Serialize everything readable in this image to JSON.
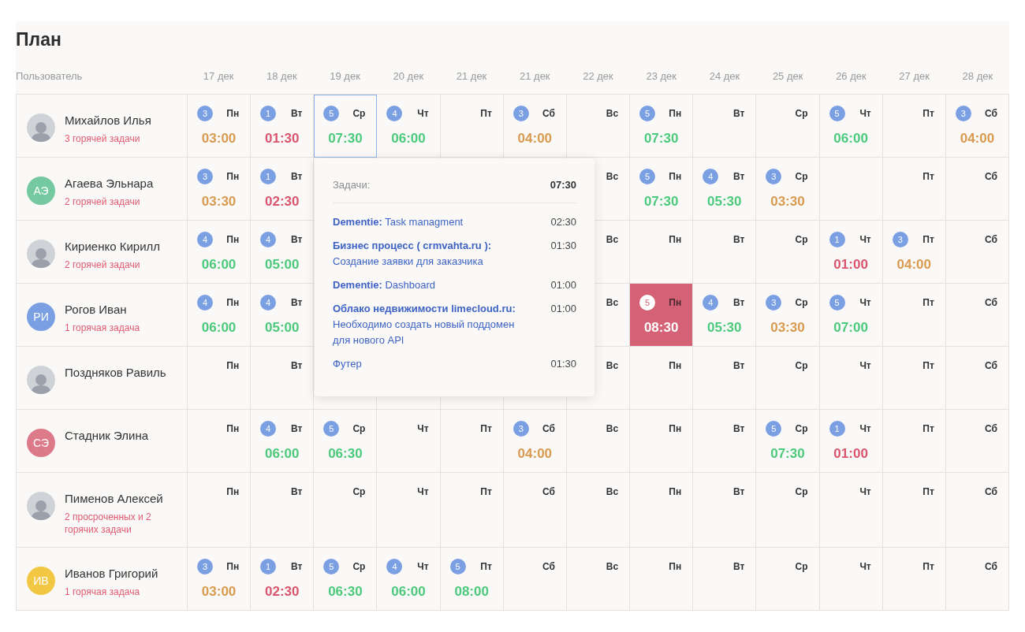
{
  "title": "План",
  "header": {
    "user_column": "Пользователь",
    "dates": [
      "17 дек",
      "18 дек",
      "19 дек",
      "20 дек",
      "21 дек",
      "21 дек",
      "22 дек",
      "23 дек",
      "24 дек",
      "25 дек",
      "26 дек",
      "27 дек",
      "28 дек"
    ]
  },
  "rows": [
    {
      "name": "Михайлов Илья",
      "note": "3 горячей задачи",
      "avatar": {
        "kind": "photo"
      },
      "cells": [
        {
          "day": "Пн",
          "count": "3",
          "time": "03:00",
          "color": "#d99a4e"
        },
        {
          "day": "Вт",
          "count": "1",
          "time": "01:30",
          "color": "#d9546c"
        },
        {
          "day": "Ср",
          "count": "5",
          "time": "07:30",
          "color": "#4cc97a",
          "selected": true
        },
        {
          "day": "Чт",
          "count": "4",
          "time": "06:00",
          "color": "#4cc97a"
        },
        {
          "day": "Пт"
        },
        {
          "day": "Сб",
          "count": "3",
          "time": "04:00",
          "color": "#d99a4e"
        },
        {
          "day": "Вс"
        },
        {
          "day": "Пн",
          "count": "5",
          "time": "07:30",
          "color": "#4cc97a"
        },
        {
          "day": "Вт"
        },
        {
          "day": "Ср"
        },
        {
          "day": "Чт",
          "count": "5",
          "time": "06:00",
          "color": "#4cc97a"
        },
        {
          "day": "Пт"
        },
        {
          "day": "Сб",
          "count": "3",
          "time": "04:00",
          "color": "#d99a4e"
        }
      ]
    },
    {
      "name": "Агаева Эльнара",
      "note": "2 горячей задачи",
      "avatar": {
        "kind": "initials",
        "initials": "АЭ",
        "color": "#74c9a0"
      },
      "cells": [
        {
          "day": "Пн",
          "count": "3",
          "time": "03:30",
          "color": "#d99a4e"
        },
        {
          "day": "Вт",
          "count": "1",
          "time": "02:30",
          "color": "#d9546c"
        },
        null,
        null,
        null,
        null,
        {
          "day": "Вс"
        },
        {
          "day": "Пн",
          "count": "5",
          "time": "07:30",
          "color": "#4cc97a"
        },
        {
          "day": "Вт",
          "count": "4",
          "time": "05:30",
          "color": "#4cc97a"
        },
        {
          "day": "Ср",
          "count": "3",
          "time": "03:30",
          "color": "#d99a4e"
        },
        {},
        {
          "day": "Пт"
        },
        {
          "day": "Сб"
        }
      ]
    },
    {
      "name": "Кириенко Кирилл",
      "note": "2 горячей задачи",
      "avatar": {
        "kind": "photo"
      },
      "cells": [
        {
          "day": "Пн",
          "count": "4",
          "time": "06:00",
          "color": "#4cc97a"
        },
        {
          "day": "Вт",
          "count": "4",
          "time": "05:00",
          "color": "#4cc97a"
        },
        null,
        null,
        null,
        null,
        {
          "day": "Вс"
        },
        {
          "day": "Пн"
        },
        {
          "day": "Вт"
        },
        {
          "day": "Ср"
        },
        {
          "day": "Чт",
          "count": "1",
          "time": "01:00",
          "color": "#d9546c"
        },
        {
          "day": "Пт",
          "count": "3",
          "time": "04:00",
          "color": "#d99a4e"
        },
        {
          "day": "Сб"
        }
      ]
    },
    {
      "name": "Рогов Иван",
      "note": "1 горячая задача",
      "avatar": {
        "kind": "initials",
        "initials": "РИ",
        "color": "#7b9fe3"
      },
      "cells": [
        {
          "day": "Пн",
          "count": "4",
          "time": "06:00",
          "color": "#4cc97a"
        },
        {
          "day": "Вт",
          "count": "4",
          "time": "05:00",
          "color": "#4cc97a"
        },
        null,
        null,
        null,
        null,
        {
          "day": "Вс"
        },
        {
          "day": "Пн",
          "count": "5",
          "time": "08:30",
          "color": "#ffffff",
          "highlighted": true
        },
        {
          "day": "Вт",
          "count": "4",
          "time": "05:30",
          "color": "#4cc97a"
        },
        {
          "day": "Ср",
          "count": "3",
          "time": "03:30",
          "color": "#d99a4e"
        },
        {
          "day": "Чт",
          "count": "5",
          "time": "07:00",
          "color": "#4cc97a"
        },
        {
          "day": "Пт"
        },
        {
          "day": "Сб"
        }
      ]
    },
    {
      "name": "Поздняков Равиль",
      "avatar": {
        "kind": "photo"
      },
      "cells": [
        {
          "day": "Пн"
        },
        {
          "day": "Вт"
        },
        null,
        null,
        null,
        null,
        {
          "day": "Вс"
        },
        {
          "day": "Пн"
        },
        {
          "day": "Вт"
        },
        {
          "day": "Ср"
        },
        {
          "day": "Чт"
        },
        {
          "day": "Пт"
        },
        {
          "day": "Сб"
        }
      ]
    },
    {
      "name": "Стадник Элина",
      "avatar": {
        "kind": "initials",
        "initials": "СЭ",
        "color": "#dc7a8a"
      },
      "cells": [
        {
          "day": "Пн"
        },
        {
          "day": "Вт",
          "count": "4",
          "time": "06:00",
          "color": "#4cc97a"
        },
        {
          "day": "Ср",
          "count": "5",
          "time": "06:30",
          "color": "#4cc97a"
        },
        {
          "day": "Чт"
        },
        {
          "day": "Пт"
        },
        {
          "day": "Сб",
          "count": "3",
          "time": "04:00",
          "color": "#d99a4e"
        },
        {
          "day": "Вс"
        },
        {
          "day": "Пн"
        },
        {
          "day": "Вт"
        },
        {
          "day": "Ср",
          "count": "5",
          "time": "07:30",
          "color": "#4cc97a"
        },
        {
          "day": "Чт",
          "count": "1",
          "time": "01:00",
          "color": "#d9546c"
        },
        {
          "day": "Пт"
        },
        {
          "day": "Сб"
        }
      ]
    },
    {
      "name": "Пименов Алексей",
      "note": "2 просроченных и 2 горячих задачи",
      "avatar": {
        "kind": "photo"
      },
      "cells": [
        {
          "day": "Пн"
        },
        {
          "day": "Вт"
        },
        {
          "day": "Ср"
        },
        {
          "day": "Чт"
        },
        {
          "day": "Пт"
        },
        {
          "day": "Сб"
        },
        {
          "day": "Вс"
        },
        {
          "day": "Пн"
        },
        {
          "day": "Вт"
        },
        {
          "day": "Ср"
        },
        {
          "day": "Чт"
        },
        {
          "day": "Пт"
        },
        {
          "day": "Сб"
        }
      ]
    },
    {
      "name": "Иванов Григорий",
      "note": "1 горячая задача",
      "avatar": {
        "kind": "initials",
        "initials": "ИВ",
        "color": "#f2c744"
      },
      "cells": [
        {
          "day": "Пн",
          "count": "3",
          "time": "03:00",
          "color": "#d99a4e"
        },
        {
          "day": "Вт",
          "count": "1",
          "time": "02:30",
          "color": "#d9546c"
        },
        {
          "day": "Ср",
          "count": "5",
          "time": "06:30",
          "color": "#4cc97a"
        },
        {
          "day": "Чт",
          "count": "4",
          "time": "06:00",
          "color": "#4cc97a"
        },
        {
          "day": "Пт",
          "count": "5",
          "time": "08:00",
          "color": "#4cc97a"
        },
        {
          "day": "Сб"
        },
        {
          "day": "Вс"
        },
        {
          "day": "Пн"
        },
        {
          "day": "Вт"
        },
        {
          "day": "Ср"
        },
        {
          "day": "Чт"
        },
        {
          "day": "Пт"
        },
        {
          "day": "Сб"
        }
      ]
    }
  ],
  "popover": {
    "label": "Задачи:",
    "total": "07:30",
    "tasks": [
      {
        "text": "**Dementie:** Task managment",
        "time": "02:30"
      },
      {
        "text": "**Бизнес процесс ( crmvahta.ru ):** Создание заявки для заказчика",
        "time": "01:30"
      },
      {
        "text": "**Dementie:** Dashboard",
        "time": "01:00"
      },
      {
        "text": "**Облако недвижимости limecloud.ru:** Необходимо создать новый поддомен для нового API",
        "time": "01:00"
      },
      {
        "text": "Футер",
        "time": "01:30"
      }
    ]
  }
}
